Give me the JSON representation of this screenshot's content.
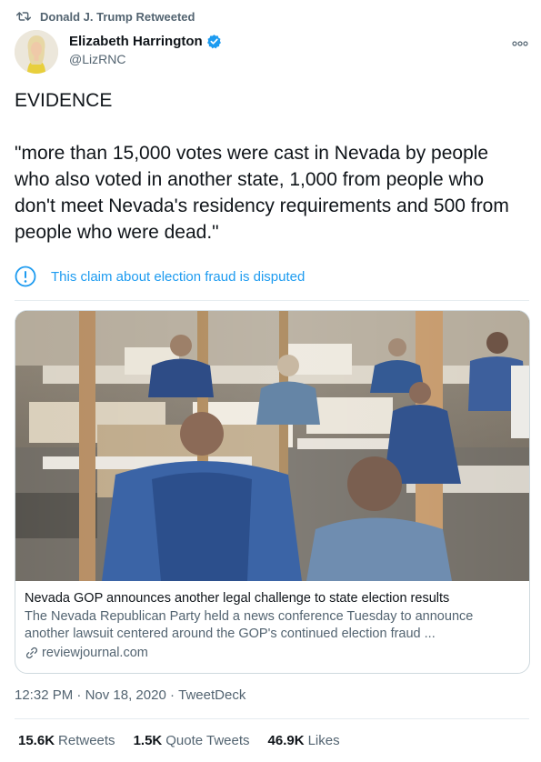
{
  "retweet": {
    "label": "Donald J. Trump Retweeted"
  },
  "author": {
    "display_name": "Elizabeth Harrington",
    "handle": "@LizRNC",
    "verified": true
  },
  "tweet": {
    "lines": [
      "EVIDENCE",
      "\"more than 15,000 votes were cast in Nevada by people who also voted in another state, 1,000 from people who don't meet Nevada's residency requirements and 500 from people who were dead.\""
    ]
  },
  "label": {
    "text": "This claim about election fraud is disputed"
  },
  "card": {
    "title": "Nevada GOP announces another legal challenge to state election results",
    "description": "The Nevada Republican Party held a news conference Tuesday to announce another lawsuit centered around the GOP's continued election fraud ...",
    "domain": "reviewjournal.com"
  },
  "meta": {
    "time": "12:32 PM",
    "date": "Nov 18, 2020",
    "separator": " · ",
    "source": "TweetDeck"
  },
  "stats": {
    "retweets_count": "15.6K",
    "retweets_label": "Retweets",
    "quotes_count": "1.5K",
    "quotes_label": "Quote Tweets",
    "likes_count": "46.9K",
    "likes_label": "Likes"
  },
  "colors": {
    "link_blue": "#1d9bf0",
    "secondary_text": "#536471",
    "verified_blue": "#1d9bf0"
  }
}
